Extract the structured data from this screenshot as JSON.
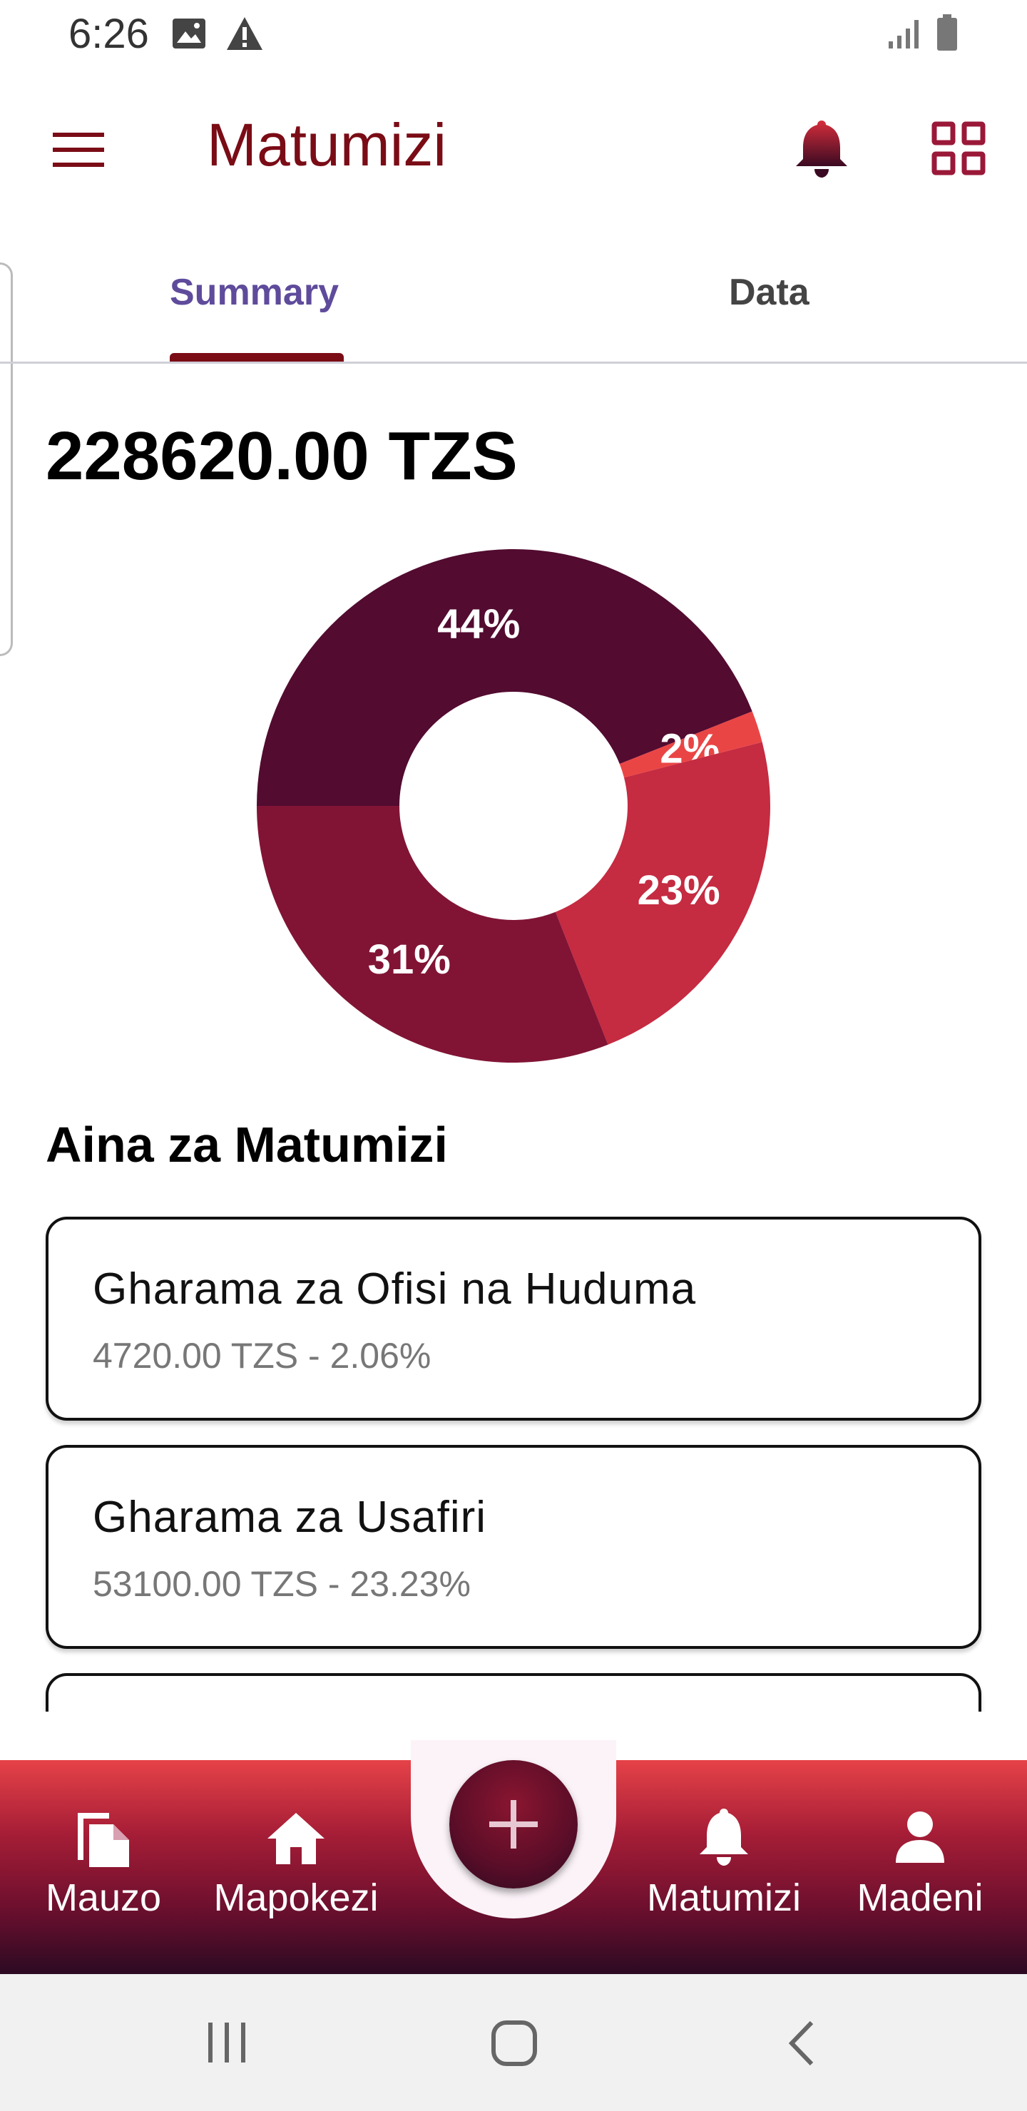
{
  "status_bar": {
    "time": "6:26",
    "icons": [
      "image-icon",
      "warning-icon",
      "signal-icon",
      "battery-icon"
    ]
  },
  "app_bar": {
    "title": "Matumizi",
    "icons": [
      "menu-icon",
      "bell-icon",
      "grid-icon"
    ]
  },
  "tabs": [
    {
      "label": "Summary",
      "active": true
    },
    {
      "label": "Data",
      "active": false
    }
  ],
  "total": "228620.00 TZS",
  "chart_data": {
    "type": "pie",
    "donut": true,
    "slices": [
      {
        "label": "44%",
        "value": 44,
        "color": "#530b30"
      },
      {
        "label": "2%",
        "value": 2,
        "color": "#ea4545"
      },
      {
        "label": "23%",
        "value": 23,
        "color": "#c52b41"
      },
      {
        "label": "31%",
        "value": 31,
        "color": "#811435"
      }
    ]
  },
  "section_title": "Aina za Matumizi",
  "categories": [
    {
      "name": "Gharama za Ofisi na Huduma",
      "detail": "4720.00 TZS - 2.06%"
    },
    {
      "name": "Gharama za Usafiri",
      "detail": "53100.00 TZS - 23.23%"
    },
    {
      "name": "",
      "detail": ""
    }
  ],
  "bottom_nav": [
    {
      "label": "Mauzo",
      "icon": "files-icon"
    },
    {
      "label": "Mapokezi",
      "icon": "home-icon"
    },
    {
      "label": "Matumizi",
      "icon": "bell-icon"
    },
    {
      "label": "Madeni",
      "icon": "person-icon"
    }
  ],
  "fab": {
    "icon": "plus-icon"
  },
  "colors": {
    "brand": "#7a0c16",
    "tab_active": "#5f4b9b"
  }
}
